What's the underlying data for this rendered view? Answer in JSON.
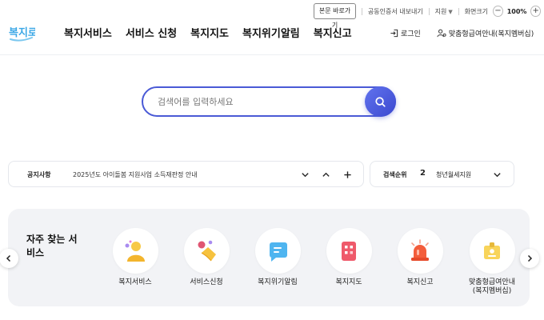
{
  "utility": {
    "skip_label": "본문 바로가기",
    "cert_label": "공동인증서 내보내기",
    "lang_label": "지원",
    "zoom_label": "화면크기",
    "zoom_value": "100%",
    "zoom_minus": "−",
    "zoom_plus": "+"
  },
  "logo": {
    "text": "복지로"
  },
  "nav": {
    "items": [
      {
        "label": "복지서비스"
      },
      {
        "label": "서비스 신청"
      },
      {
        "label": "복지지도"
      },
      {
        "label": "복지위기알림"
      },
      {
        "label": "복지신고"
      }
    ]
  },
  "header_right": {
    "login_label": "로그인",
    "membership_label": "맞춤형급여안내(복지멤버십)"
  },
  "search": {
    "placeholder": "검색어를 입력하세요",
    "value": ""
  },
  "notice": {
    "label": "공지사항",
    "text": "2025년도 아이돌봄 지원사업 소득재판정 안내"
  },
  "search_rank": {
    "label": "검색순위",
    "number": "2",
    "term": "청년월세지원"
  },
  "frequent": {
    "title": "자주 찾는 서비스",
    "items": [
      {
        "label": "복지서비스"
      },
      {
        "label": "서비스신청"
      },
      {
        "label": "복지위기알림"
      },
      {
        "label": "복지지도"
      },
      {
        "label": "복지신고"
      },
      {
        "label": "맞춤형급여안내\n(복지멤버십)"
      }
    ]
  },
  "colors": {
    "accent": "#4a5ad6",
    "logo_blue": "#3aa7e6",
    "panel_bg": "#f2f3f6"
  },
  "icons": [
    "search-icon",
    "login-icon",
    "user-gear-icon",
    "chevron-down-icon",
    "chevron-up-icon",
    "plus-icon",
    "chevron-left-icon",
    "chevron-right-icon"
  ]
}
